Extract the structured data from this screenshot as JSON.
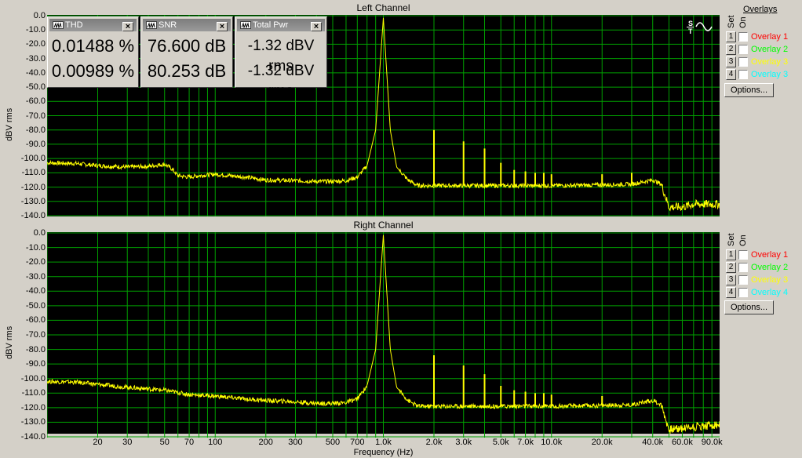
{
  "left_channel": {
    "title": "Left Channel",
    "ylabel": "dBV rms",
    "xlabel": "Frequency (Hz)"
  },
  "right_channel": {
    "title": "Right Channel",
    "ylabel": "dBV rms"
  },
  "y_ticks": [
    "0.0",
    "-10.0",
    "-20.0",
    "-30.0",
    "-40.0",
    "-50.0",
    "-60.0",
    "-70.0",
    "-80.0",
    "-90.0",
    "-100.0",
    "-110.0",
    "-120.0",
    "-130.0",
    "-140.0"
  ],
  "x_ticks": [
    {
      "f": 20,
      "label": "20"
    },
    {
      "f": 30,
      "label": "30"
    },
    {
      "f": 50,
      "label": "50"
    },
    {
      "f": 70,
      "label": "70"
    },
    {
      "f": 100,
      "label": "100"
    },
    {
      "f": 200,
      "label": "200"
    },
    {
      "f": 300,
      "label": "300"
    },
    {
      "f": 500,
      "label": "500"
    },
    {
      "f": 700,
      "label": "700"
    },
    {
      "f": 1000,
      "label": "1.0k"
    },
    {
      "f": 2000,
      "label": "2.0k"
    },
    {
      "f": 3000,
      "label": "3.0k"
    },
    {
      "f": 5000,
      "label": "5.0k"
    },
    {
      "f": 7000,
      "label": "7.0k"
    },
    {
      "f": 10000,
      "label": "10.0k"
    },
    {
      "f": 20000,
      "label": "20.0k"
    },
    {
      "f": 40000,
      "label": "40.0k"
    },
    {
      "f": 60000,
      "label": "60.0k"
    },
    {
      "f": 90000,
      "label": "90.0k"
    }
  ],
  "meters": {
    "thd": {
      "title": "THD",
      "left": "0.01488 %",
      "right": "0.00989 %"
    },
    "snr": {
      "title": "SNR",
      "left": "76.600 dB",
      "right": "80.253 dB"
    },
    "pwr": {
      "title": "Total Pwr",
      "left": "-1.32 dBV rms",
      "right": "-1.32 dBV rms"
    }
  },
  "overlays_top": {
    "header": "Overlays",
    "set_label": "Set",
    "on_label": "On",
    "items": [
      {
        "num": "1",
        "label": "Overlay 1",
        "color": "#ff0000"
      },
      {
        "num": "2",
        "label": "Overlay 2",
        "color": "#00ff00"
      },
      {
        "num": "3",
        "label": "Overlay 3",
        "color": "#ffff00"
      },
      {
        "num": "4",
        "label": "Overlay 3",
        "color": "#00ffff"
      }
    ],
    "options_label": "Options..."
  },
  "overlays_bottom": {
    "set_label": "Set",
    "on_label": "On",
    "items": [
      {
        "num": "1",
        "label": "Overlay 1",
        "color": "#ff0000"
      },
      {
        "num": "2",
        "label": "Overlay 2",
        "color": "#00ff00"
      },
      {
        "num": "3",
        "label": "Overlay 3",
        "color": "#ffff00"
      },
      {
        "num": "4",
        "label": "Overlay 4",
        "color": "#00ffff"
      }
    ],
    "options_label": "Options..."
  },
  "colors": {
    "plot_bg": "#000000",
    "grid": "#00a000",
    "trace": "#ffff00"
  },
  "chart_data": [
    {
      "type": "line",
      "title": "Left Channel",
      "xlabel": "Frequency (Hz)",
      "ylabel": "dBV rms",
      "x_scale": "log",
      "xlim": [
        10,
        100000
      ],
      "ylim": [
        -140,
        0
      ],
      "grid": true,
      "series": [
        {
          "points": [
            [
              10,
              -103
            ],
            [
              15,
              -103.5
            ],
            [
              20,
              -105
            ],
            [
              30,
              -106
            ],
            [
              40,
              -105.5
            ],
            [
              50,
              -104
            ],
            [
              55,
              -107
            ],
            [
              60,
              -112
            ],
            [
              70,
              -113
            ],
            [
              80,
              -112
            ],
            [
              100,
              -111
            ],
            [
              150,
              -113
            ],
            [
              200,
              -115
            ],
            [
              300,
              -115.5
            ],
            [
              400,
              -116
            ],
            [
              500,
              -116
            ],
            [
              600,
              -115.5
            ],
            [
              700,
              -113
            ],
            [
              800,
              -105
            ],
            [
              900,
              -80
            ],
            [
              1000,
              -1.5
            ],
            [
              1100,
              -80
            ],
            [
              1200,
              -106
            ],
            [
              1400,
              -115
            ],
            [
              1600,
              -119
            ],
            [
              2000,
              -119
            ],
            [
              3000,
              -119
            ],
            [
              5000,
              -119
            ],
            [
              10000,
              -119
            ],
            [
              20000,
              -118.5
            ],
            [
              30000,
              -118
            ],
            [
              40000,
              -115
            ],
            [
              45000,
              -118
            ],
            [
              50000,
              -134
            ],
            [
              60000,
              -134
            ],
            [
              70000,
              -132
            ],
            [
              90000,
              -132
            ]
          ]
        }
      ],
      "harmonics": [
        [
          2000,
          -80
        ],
        [
          3000,
          -88
        ],
        [
          4000,
          -93
        ],
        [
          5000,
          -103
        ],
        [
          6000,
          -108
        ],
        [
          7000,
          -109
        ],
        [
          8000,
          -110
        ],
        [
          9000,
          -110
        ],
        [
          10000,
          -111
        ],
        [
          20000,
          -111
        ],
        [
          30000,
          -110
        ]
      ]
    },
    {
      "type": "line",
      "title": "Right Channel",
      "xlabel": "Frequency (Hz)",
      "ylabel": "dBV rms",
      "x_scale": "log",
      "xlim": [
        10,
        100000
      ],
      "ylim": [
        -140,
        0
      ],
      "grid": true,
      "series": [
        {
          "points": [
            [
              10,
              -102
            ],
            [
              15,
              -102.5
            ],
            [
              20,
              -104
            ],
            [
              30,
              -106
            ],
            [
              50,
              -108
            ],
            [
              70,
              -111
            ],
            [
              100,
              -112
            ],
            [
              150,
              -114
            ],
            [
              200,
              -115
            ],
            [
              300,
              -116
            ],
            [
              400,
              -117
            ],
            [
              500,
              -117
            ],
            [
              600,
              -116.5
            ],
            [
              700,
              -114
            ],
            [
              800,
              -105
            ],
            [
              900,
              -80
            ],
            [
              1000,
              -1.5
            ],
            [
              1100,
              -80
            ],
            [
              1200,
              -106
            ],
            [
              1400,
              -115
            ],
            [
              1600,
              -119
            ],
            [
              2000,
              -119
            ],
            [
              3000,
              -119
            ],
            [
              5000,
              -119
            ],
            [
              10000,
              -119
            ],
            [
              20000,
              -118.5
            ],
            [
              30000,
              -118
            ],
            [
              40000,
              -115
            ],
            [
              45000,
              -118
            ],
            [
              50000,
              -135
            ],
            [
              60000,
              -134
            ],
            [
              70000,
              -133
            ],
            [
              90000,
              -132
            ]
          ]
        }
      ],
      "harmonics": [
        [
          2000,
          -84
        ],
        [
          3000,
          -91
        ],
        [
          4000,
          -97
        ],
        [
          5000,
          -105
        ],
        [
          6000,
          -108
        ],
        [
          7000,
          -109
        ],
        [
          8000,
          -110
        ],
        [
          9000,
          -110
        ],
        [
          10000,
          -111
        ],
        [
          20000,
          -112
        ]
      ]
    }
  ]
}
